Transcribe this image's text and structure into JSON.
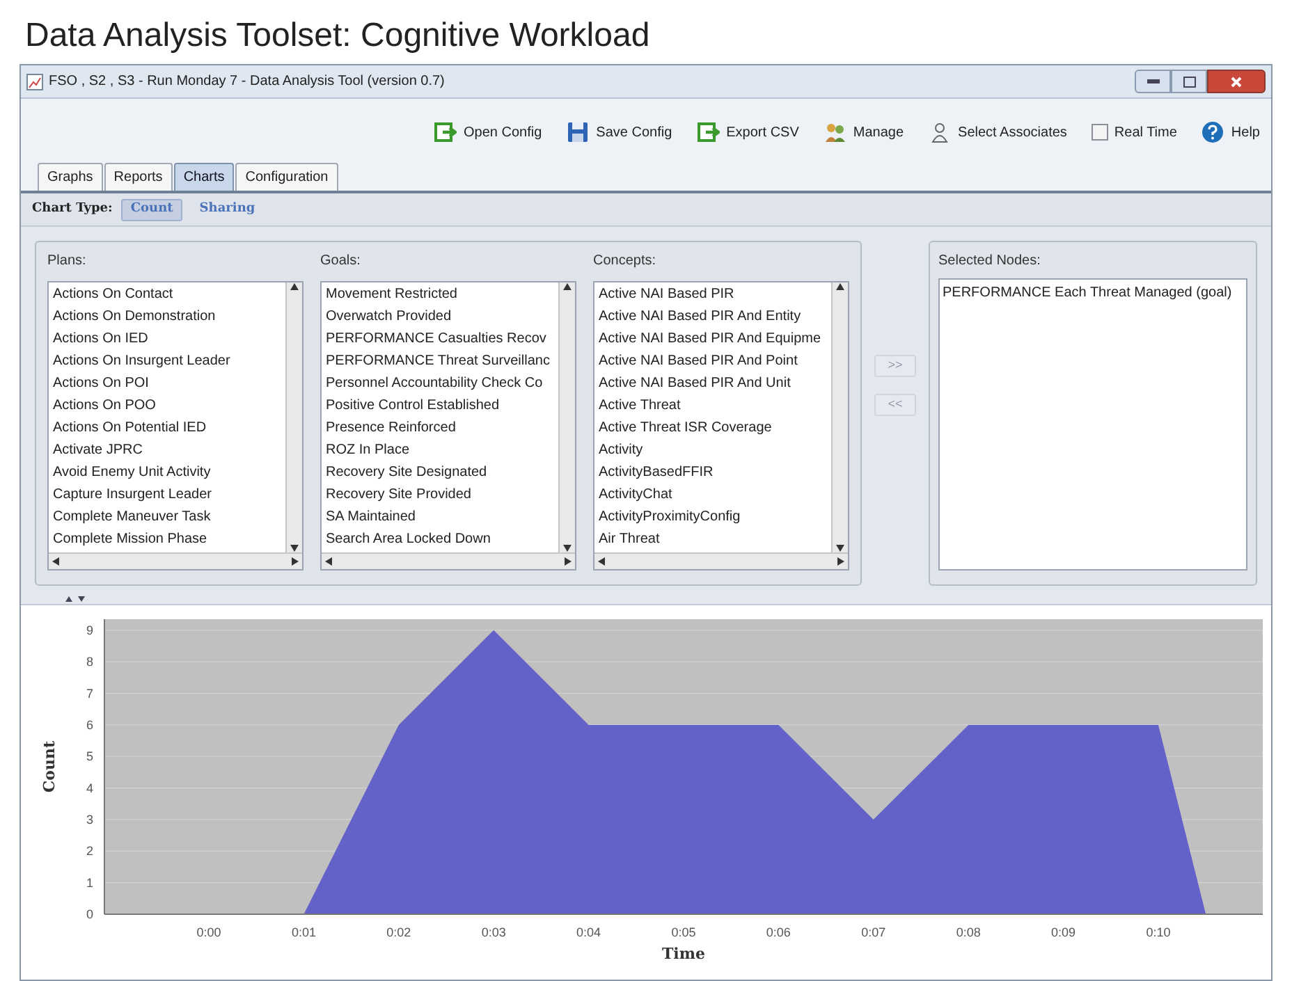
{
  "page_title": "Data Analysis Toolset: Cognitive Workload",
  "window": {
    "title": "FSO , S2 , S3 - Run Monday 7 - Data Analysis Tool (version 0.7)"
  },
  "toolbar": [
    {
      "kind": "open",
      "label": "Open Config"
    },
    {
      "kind": "save",
      "label": "Save Config"
    },
    {
      "kind": "export",
      "label": "Export CSV"
    },
    {
      "kind": "manage",
      "label": "Manage"
    },
    {
      "kind": "associates",
      "label": "Select Associates"
    },
    {
      "kind": "checkbox",
      "label": "Real Time",
      "checked": false
    },
    {
      "kind": "help",
      "label": "Help"
    }
  ],
  "tabs": [
    {
      "label": "Graphs",
      "selected": false
    },
    {
      "label": "Reports",
      "selected": false
    },
    {
      "label": "Charts",
      "selected": true
    },
    {
      "label": "Configuration",
      "selected": false
    }
  ],
  "chart_type": {
    "label": "Chart Type:",
    "options": [
      {
        "label": "Count",
        "selected": true
      },
      {
        "label": "Sharing",
        "selected": false
      }
    ]
  },
  "lists": [
    {
      "title": "Plans:",
      "items": [
        "Actions On Contact",
        "Actions On Demonstration",
        "Actions On IED",
        "Actions On Insurgent Leader",
        "Actions On POI",
        "Actions On POO",
        "Actions On Potential IED",
        "Activate JPRC",
        "Avoid Enemy Unit Activity",
        "Capture Insurgent Leader",
        "Complete Maneuver Task",
        "Complete Mission Phase"
      ]
    },
    {
      "title": "Goals:",
      "items": [
        "Movement Restricted",
        "Overwatch Provided",
        "PERFORMANCE Casualties Recov",
        "PERFORMANCE Threat Surveillanc",
        "Personnel Accountability Check Co",
        "Positive Control Established",
        "Presence Reinforced",
        "ROZ In Place",
        "Recovery Site Designated",
        "Recovery Site Provided",
        "SA Maintained",
        "Search Area Locked Down"
      ]
    },
    {
      "title": "Concepts:",
      "items": [
        "Active NAI Based PIR",
        "Active NAI Based PIR And Entity",
        "Active NAI Based PIR And Equipme",
        "Active NAI Based PIR And Point",
        "Active NAI Based PIR And Unit",
        "Active Threat",
        "Active Threat ISR Coverage",
        "Activity",
        "ActivityBasedFFIR",
        "ActivityChat",
        "ActivityProximityConfig",
        "Air Threat"
      ]
    }
  ],
  "transfer_buttons": [
    ">>",
    "<<"
  ],
  "selected_nodes": {
    "title": "Selected Nodes:",
    "items": [
      "PERFORMANCE Each Threat Managed (goal)"
    ]
  },
  "chart": {
    "chart_data": {
      "type": "area",
      "xlabel": "Time",
      "ylabel": "Count",
      "x": [
        0,
        1,
        2,
        3,
        4,
        5,
        6,
        7,
        8,
        9,
        10,
        10.5
      ],
      "grid": true,
      "series": [
        {
          "color": "#6262c8",
          "values": [
            0,
            0,
            6,
            9,
            6,
            6,
            6,
            3,
            6,
            6,
            6,
            0
          ]
        }
      ],
      "xlim": [
        -1.1,
        11.1
      ],
      "ylim": [
        0,
        9.35
      ],
      "xticks": [
        {
          "value": 0,
          "label": "0:00"
        },
        {
          "value": 1,
          "label": "0:01"
        },
        {
          "value": 2,
          "label": "0:02"
        },
        {
          "value": 3,
          "label": "0:03"
        },
        {
          "value": 4,
          "label": "0:04"
        },
        {
          "value": 5,
          "label": "0:05"
        },
        {
          "value": 6,
          "label": "0:06"
        },
        {
          "value": 7,
          "label": "0:07"
        },
        {
          "value": 8,
          "label": "0:08"
        },
        {
          "value": 9,
          "label": "0:09"
        },
        {
          "value": 10,
          "label": "0:10"
        }
      ],
      "yticks": [
        0,
        1,
        2,
        3,
        4,
        5,
        6,
        7,
        8,
        9
      ]
    }
  }
}
